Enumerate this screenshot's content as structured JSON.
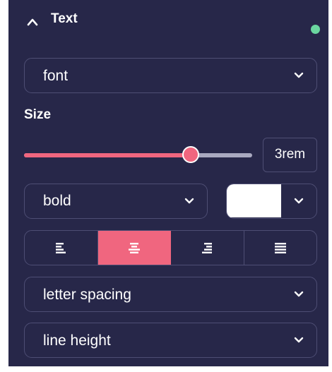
{
  "panel": {
    "title": "Text",
    "status_color": "#6bd6a0",
    "collapse_icon": "chevron-up-icon"
  },
  "font_select": {
    "value": "font"
  },
  "size": {
    "label": "Size",
    "value": "3rem",
    "slider_fraction": 0.73
  },
  "weight_select": {
    "value": "bold"
  },
  "color": {
    "value": "#ffffff"
  },
  "alignment": {
    "options": [
      "left",
      "center",
      "right",
      "justify"
    ],
    "selected": "center"
  },
  "letter_spacing_select": {
    "value": "letter spacing"
  },
  "line_height_select": {
    "value": "line height"
  },
  "colors": {
    "panel_bg": "#272749",
    "border": "#4e4e74",
    "accent": "#f0667f",
    "track": "#a9a9c0"
  }
}
